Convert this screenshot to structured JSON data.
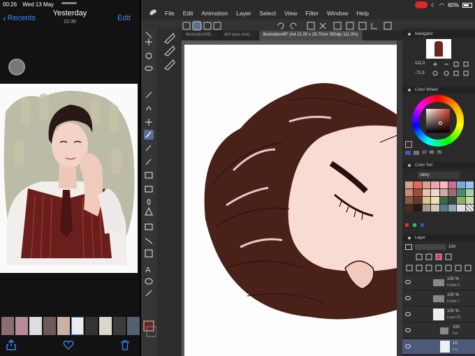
{
  "photos": {
    "status_time": "00:26",
    "status_date": "Wed 13 May",
    "back_label": "Recents",
    "title": "Yesterday",
    "subtitle": "22:30",
    "edit_label": "Edit"
  },
  "csp": {
    "menu": [
      "File",
      "Edit",
      "Animation",
      "Layer",
      "Select",
      "View",
      "Filter",
      "Window",
      "Help"
    ],
    "battery": "60%",
    "tabs": [
      "illustration39(…",
      "doll eyes test(…",
      "illustration45* (A4 21.00 x 29.70cm 350dpi 111.0%)"
    ],
    "navigator": {
      "title": "Navigator",
      "zoom": "111.0",
      "angle": "-71.9"
    },
    "color_wheel": {
      "title": "Color Wheel",
      "h": "10",
      "s": "88",
      "v": "35"
    },
    "color_set": {
      "title": "Color Set",
      "set_name": "takky"
    },
    "layer": {
      "title": "Layer",
      "opacity": "100",
      "rows": [
        {
          "pct": "100 %",
          "name": "Folder 5"
        },
        {
          "pct": "100 %",
          "name": "Folder 7"
        },
        {
          "pct": "100 %",
          "name": "Layer 51"
        },
        {
          "pct": "100",
          "name": "Fol"
        },
        {
          "pct": "10",
          "name": "Lay"
        }
      ]
    }
  },
  "colors": {
    "accent": "#3b8bff",
    "rec": "#e0262a",
    "hair": "#4a2119",
    "skin": "#f6d9cf"
  }
}
